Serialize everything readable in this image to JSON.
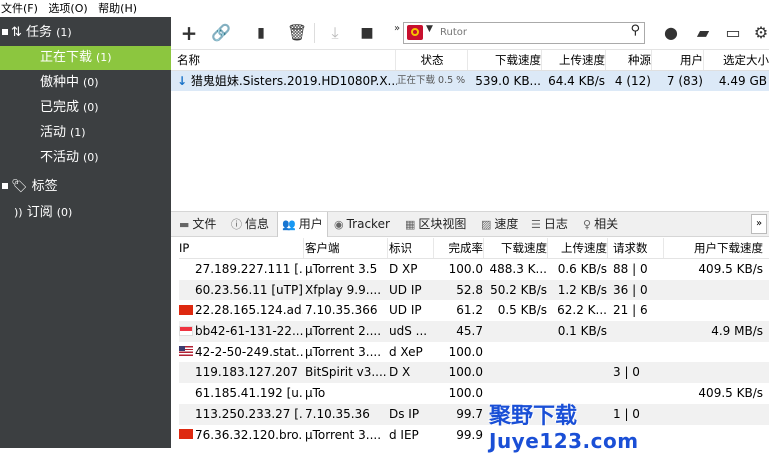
{
  "menu": [
    "文件(F)",
    "选项(O)",
    "帮助(H)"
  ],
  "sidebar": {
    "tasks": {
      "label": "任务",
      "count": "(1)"
    },
    "items": [
      {
        "label": "正在下载",
        "count": "(1)"
      },
      {
        "label": "傲种中",
        "count": "(0)"
      },
      {
        "label": "已完成",
        "count": "(0)"
      },
      {
        "label": "活动",
        "count": "(1)"
      },
      {
        "label": "不活动",
        "count": "(0)"
      }
    ],
    "labels": {
      "label": "标签"
    },
    "feeds": {
      "label": "订阅",
      "count": "(0)"
    }
  },
  "search": {
    "placeholder": "Rutor"
  },
  "torrent_table": {
    "headers": [
      "名称",
      "状态",
      "下载速度",
      "上传速度",
      "种源",
      "用户",
      "选定大小"
    ],
    "rows": [
      {
        "name": "猎鬼姐妹.Sisters.2019.HD1080P.X...",
        "status": "正在下载 0.5 %",
        "down": "539.0 KB...",
        "up": "64.4 KB/s",
        "seeds": "4 (12)",
        "peers": "7 (83)",
        "size": "4.49 GB"
      }
    ]
  },
  "tabs": [
    "文件",
    "信息",
    "用户",
    "Tracker",
    "区块视图",
    "速度",
    "日志",
    "相关"
  ],
  "peers_table": {
    "headers": [
      "IP",
      "客户端",
      "标识",
      "完成率",
      "下载速度",
      "上传速度",
      "请求数",
      "用户下载速度"
    ],
    "rows": [
      {
        "flag": "none",
        "ip": "27.189.227.111 [...",
        "client": "µTorrent 3.5",
        "flags": "D XP",
        "pct": "100.0",
        "down": "488.3 K...",
        "up": "0.6 KB/s",
        "req": "88 | 0",
        "peerdl": "409.5 KB/s"
      },
      {
        "flag": "none",
        "ip": "60.23.56.11 [uTP]",
        "client": "Xfplay 9.9....",
        "flags": "UD IP",
        "pct": "52.8",
        "down": "50.2 KB/s",
        "up": "1.2 KB/s",
        "req": "36 | 0",
        "peerdl": ""
      },
      {
        "flag": "cn",
        "ip": "22.28.165.124.ad...",
        "client": "7.10.35.366",
        "flags": "UD IP",
        "pct": "61.2",
        "down": "0.5 KB/s",
        "up": "62.2 K...",
        "req": "21 | 6",
        "peerdl": ""
      },
      {
        "flag": "sg",
        "ip": "bb42-61-131-22...",
        "client": "µTorrent 2....",
        "flags": "udS ...",
        "pct": "45.7",
        "down": "",
        "up": "0.1 KB/s",
        "req": "",
        "peerdl": "4.9 MB/s"
      },
      {
        "flag": "us",
        "ip": "42-2-50-249.stat...",
        "client": "µTorrent 3....",
        "flags": "d XeP",
        "pct": "100.0",
        "down": "",
        "up": "",
        "req": "",
        "peerdl": ""
      },
      {
        "flag": "none",
        "ip": "119.183.127.207",
        "client": "BitSpirit v3....",
        "flags": "D X",
        "pct": "100.0",
        "down": "",
        "up": "",
        "req": "3 | 0",
        "peerdl": ""
      },
      {
        "flag": "none",
        "ip": "61.185.41.192 [u...",
        "client": "µTo",
        "flags": "",
        "pct": "100.0",
        "down": "",
        "up": "",
        "req": "",
        "peerdl": "409.5 KB/s"
      },
      {
        "flag": "none",
        "ip": "113.250.233.27 [...",
        "client": "7.10.35.36",
        "flags": "Ds IP",
        "pct": "99.7",
        "down": "",
        "up": "",
        "req": "1 | 0",
        "peerdl": ""
      },
      {
        "flag": "cn",
        "ip": "76.36.32.120.bro...",
        "client": "µTorrent 3....",
        "flags": "d IEP",
        "pct": "99.9",
        "down": "",
        "up": "",
        "req": "",
        "peerdl": ""
      }
    ]
  },
  "watermark": {
    "line1": "聚野下载",
    "line2": "Juye123.com"
  },
  "colors": {
    "sidebar_bg": "#3c3f41",
    "active_green": "#8cc63f",
    "selected_row": "#dce9f7"
  }
}
